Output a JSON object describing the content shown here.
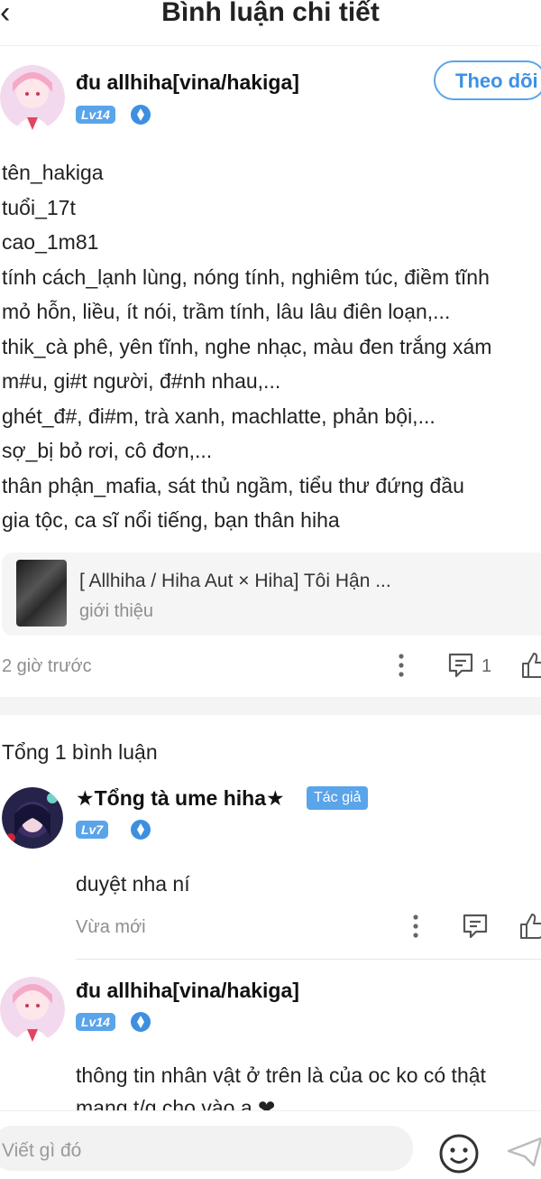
{
  "header": {
    "back_icon": "‹",
    "title": "Bình luận chi tiết"
  },
  "post": {
    "author": "đu allhiha[vina/hakiga]",
    "level": "Lv14",
    "follow_label": "Theo dõi",
    "lines": [
      "tên_hakiga",
      "tuổi_17t",
      "cao_1m81",
      "tính cách_lạnh lùng, nóng tính, nghiêm túc, điềm tĩnh",
      "mỏ hỗn, liều, ít nói, trầm tính, lâu lâu điên loạn,...",
      "thik_cà phê, yên tĩnh, nghe nhạc, màu đen trắng xám",
      "m#u, gi#t người, đ#nh nhau,...",
      "ghét_đ#, đi#m, trà xanh, machlatte, phản bội,...",
      "sợ_bị bỏ rơi, cô đơn,...",
      "thân phận_mafia, sát thủ ngầm, tiểu thư đứng đầu",
      "gia tộc, ca sĩ nổi tiếng, bạn thân hiha"
    ],
    "link_title": "[ Allhiha / Hiha Aut × Hiha] Tôi Hận ...",
    "link_subtitle": "giới thiệu",
    "time": "2 giờ trước",
    "comment_count": "1"
  },
  "comments_section": {
    "total_label": "Tổng 1 bình luận",
    "comments": [
      {
        "author": "★Tổng tà ume hiha★",
        "badge": "Tác giả",
        "level": "Lv7",
        "text": "duyệt nha ní",
        "time": "Vừa mới"
      },
      {
        "author": "đu allhiha[vina/hakiga]",
        "level": "Lv14",
        "text": "thông tin nhân vật ở trên là của oc ko có thật",
        "text2": "mang t/g cho vào ạ ❤"
      }
    ]
  },
  "composer": {
    "placeholder": "Viết gì đó"
  },
  "colors": {
    "accent": "#5aa4ea",
    "follow_text": "#3c91e6",
    "muted": "#8e8e8e"
  }
}
